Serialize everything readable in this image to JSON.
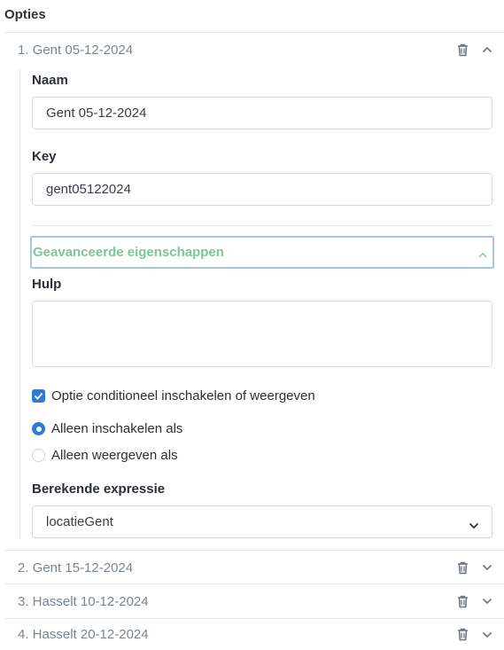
{
  "section": {
    "title": "Opties"
  },
  "options": [
    {
      "label": "1. Gent 05-12-2024",
      "expanded": true
    },
    {
      "label": "2. Gent 15-12-2024",
      "expanded": false
    },
    {
      "label": "3. Hasselt 10-12-2024",
      "expanded": false
    },
    {
      "label": "4. Hasselt 20-12-2024",
      "expanded": false
    }
  ],
  "form": {
    "name_label": "Naam",
    "name_value": "Gent 05-12-2024",
    "key_label": "Key",
    "key_value": "gent05122024",
    "advanced_title": "Geavanceerde eigenschappen",
    "help_label": "Hulp",
    "help_value": "",
    "conditional_label": "Optie conditioneel inschakelen of weergeven",
    "conditional_checked": true,
    "radio_enable_label": "Alleen inschakelen als",
    "radio_show_label": "Alleen weergeven als",
    "radio_selected": "enable",
    "expression_label": "Berekende expressie",
    "expression_value": "locatieGent"
  },
  "colors": {
    "accent": "#2d7bd6",
    "advanced_title": "#7dc59a",
    "focus_border": "#a9c5e6",
    "muted_text": "#7b8494"
  },
  "icons": [
    "trash-icon",
    "chevron-up-icon",
    "chevron-down-icon",
    "checkmark-icon"
  ]
}
